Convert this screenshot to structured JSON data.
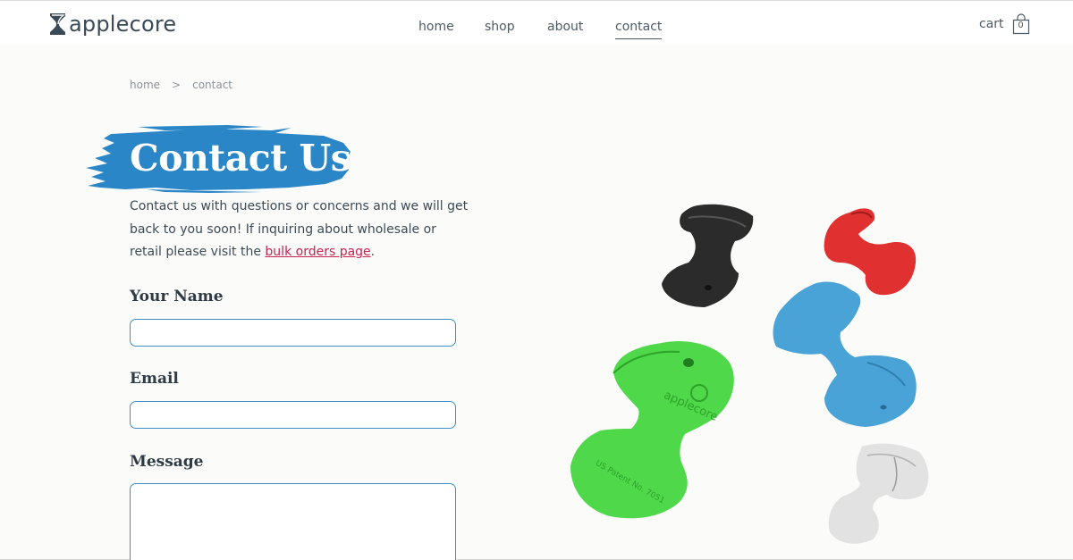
{
  "brand": {
    "name": "applecore"
  },
  "nav": {
    "home": "home",
    "shop": "shop",
    "about": "about",
    "contact": "contact"
  },
  "cart": {
    "label": "cart",
    "count": "0"
  },
  "breadcrumb": {
    "home": "home",
    "separator": ">",
    "current": "contact"
  },
  "page": {
    "title": "Contact Us",
    "intro_text": "Contact us with questions or concerns and we will get back to you soon! If inquiring about wholesale or retail please visit the ",
    "intro_link": "bulk orders page",
    "intro_end": "."
  },
  "form": {
    "name_label": "Your Name",
    "email_label": "Email",
    "message_label": "Message",
    "name_value": "",
    "email_value": "",
    "message_value": ""
  },
  "colors": {
    "accent": "#2a86c6",
    "link": "#c8234f",
    "input_border": "#3e8fc7",
    "product_black": "#2b2b2b",
    "product_red": "#e03030",
    "product_blue": "#4aa3d6",
    "product_green": "#4ed84a",
    "product_white": "#e2e2e2"
  },
  "product_image": {
    "labels": [
      "applecore",
      "US Patent No. 7051"
    ]
  }
}
